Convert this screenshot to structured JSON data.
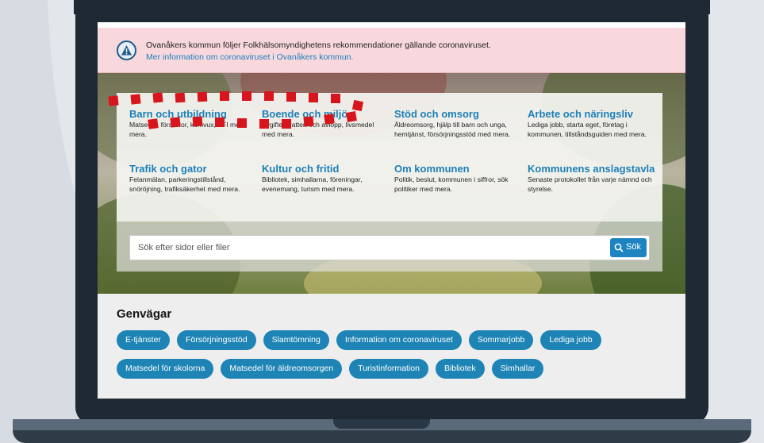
{
  "alert": {
    "text": "Ovanåkers kommun följer Folkhälsomyndighetens rekommendationer gällande coronaviruset.",
    "link": "Mer information om coronaviruset i Ovanåkers kommun."
  },
  "categories": [
    {
      "title": "Barn och utbildning",
      "desc": "Matsedel, förskolor, komvux, SFI med mera."
    },
    {
      "title": "Boende och miljö",
      "desc": "Avgifter, vatten och avlopp, livsmedel med mera."
    },
    {
      "title": "Stöd och omsorg",
      "desc": "Äldreomsorg, hjälp till barn och unga, hemtjänst, försörjningsstöd med mera."
    },
    {
      "title": "Arbete och näringsliv",
      "desc": "Lediga jobb, starta eget, företag i kommunen, tillståndsguiden med mera."
    },
    {
      "title": "Trafik och gator",
      "desc": "Felanmälan, parkeringstillstånd, snöröjning, trafiksäkerhet med mera."
    },
    {
      "title": "Kultur och fritid",
      "desc": "Bibliotek, simhallarna, föreningar, evenemang, turism med mera."
    },
    {
      "title": "Om kommunen",
      "desc": "Politik, beslut, kommunen i siffror, sök politiker med mera."
    },
    {
      "title": "Kommunens anslagstavla",
      "desc": "Senaste protokollet från varje nämnd och styrelse."
    }
  ],
  "search": {
    "placeholder": "Sök efter sidor eller filer",
    "button": "Sök"
  },
  "shortcuts": {
    "title": "Genvägar",
    "row1": [
      "E-tjänster",
      "Försörjningsstöd",
      "Slamtömning",
      "Information om coronaviruset",
      "Sommarjobb",
      "Lediga jobb"
    ],
    "row2": [
      "Matsedel för skolorna",
      "Matsedel för äldreomsorgen",
      "Turistinformation",
      "Bibliotek",
      "Simhallar"
    ]
  },
  "colors": {
    "accent": "#1d84b5",
    "alert_bg": "#f8d8dc",
    "highlight_dash": "#d8141c"
  },
  "icons": {
    "alert": "warning-triangle-icon",
    "search": "search-icon"
  }
}
